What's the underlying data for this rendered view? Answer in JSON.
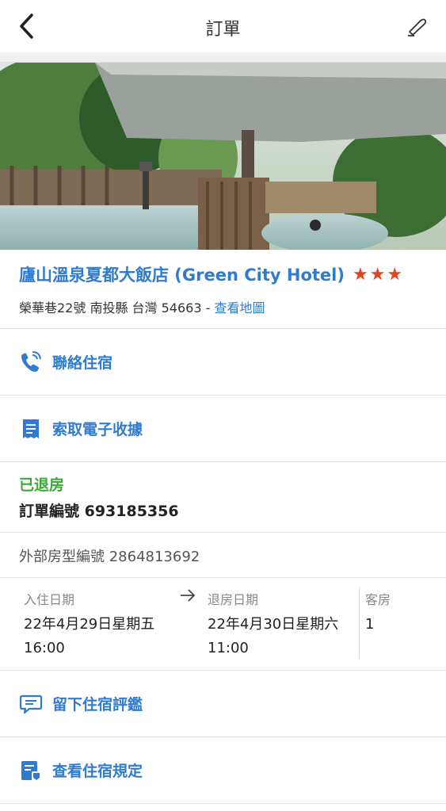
{
  "header": {
    "title": "訂單",
    "back_icon": "chevron-left-icon",
    "tool_icon": "edit-pen-icon"
  },
  "hotel": {
    "name": "廬山溫泉夏都大飯店 (Green City Hotel)",
    "stars": "★★★",
    "address": "榮華巷22號 南投縣 台灣 54663 - ",
    "map_link": "查看地圖"
  },
  "actions": {
    "contact": "聯絡住宿",
    "receipt": "索取電子收據",
    "review": "留下住宿評鑑",
    "policy": "查看住宿規定"
  },
  "booking": {
    "status": "已退房",
    "order_number": "訂單編號 693185356",
    "external_room": "外部房型編號 2864813692"
  },
  "dates": {
    "checkin_label": "入住日期",
    "checkin_date": "22年4月29日星期五",
    "checkin_time": "16:00",
    "checkout_label": "退房日期",
    "checkout_date": "22年4月30日星期六",
    "checkout_time": "11:00",
    "rooms_label": "客房",
    "rooms_value": "1"
  },
  "colors": {
    "accent": "#2f7bd0",
    "status": "#3aa83a",
    "stars": "#e5441c"
  }
}
